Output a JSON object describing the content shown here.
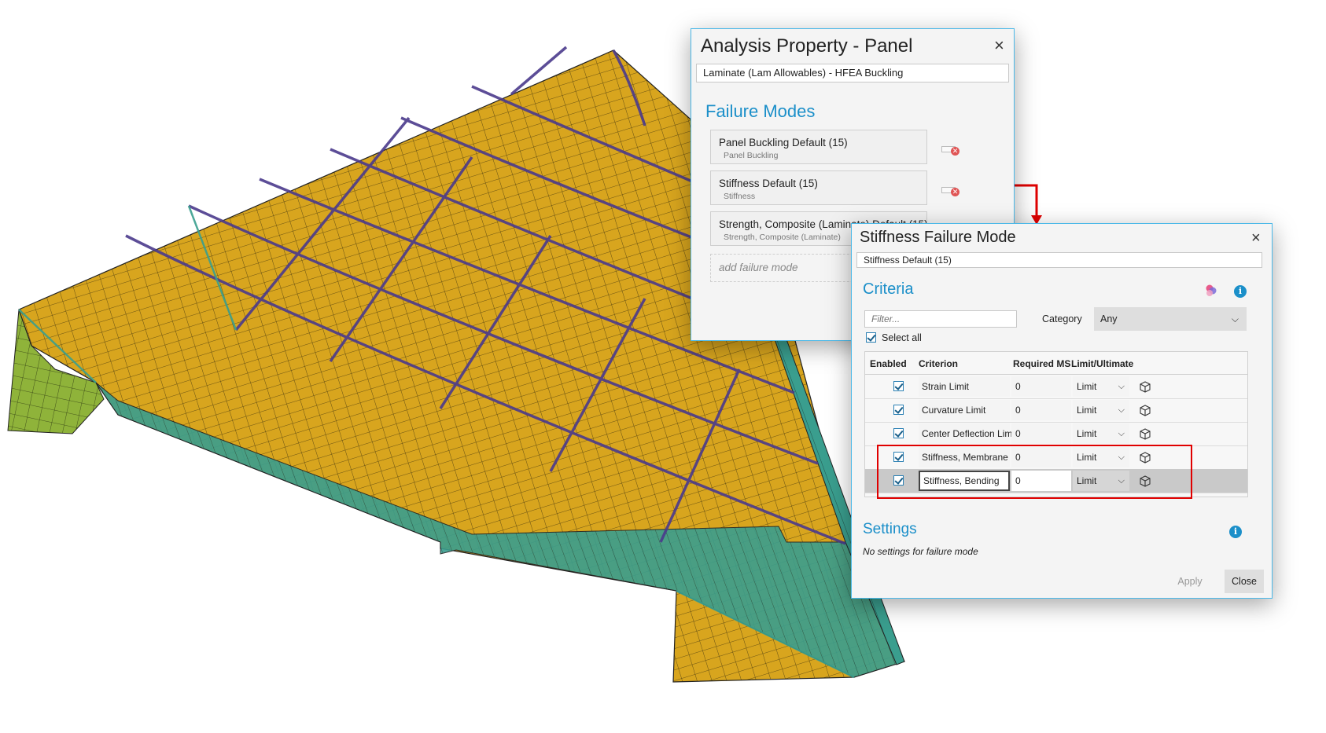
{
  "analysis_dialog": {
    "title": "Analysis Property - Panel",
    "close": "×",
    "property_name": "Laminate (Lam Allowables) - HFEA Buckling",
    "section_title": "Failure Modes",
    "failure_modes": [
      {
        "name": "Panel Buckling Default (15)",
        "type": "Panel Buckling"
      },
      {
        "name": "Stiffness Default (15)",
        "type": "Stiffness"
      },
      {
        "name": "Strength, Composite (Laminate) Default (15)",
        "type": "Strength, Composite (Laminate)"
      }
    ],
    "add_placeholder": "add failure mode"
  },
  "stiffness_dialog": {
    "title": "Stiffness Failure Mode",
    "close": "×",
    "mode_name": "Stiffness Default (15)",
    "criteria_title": "Criteria",
    "filter_placeholder": "Filter...",
    "category_label": "Category",
    "category_value": "Any",
    "select_all_label": "Select all",
    "columns": [
      "Enabled",
      "Criterion",
      "Required MS",
      "Limit/Ultimate"
    ],
    "rows": [
      {
        "criterion": "Strain Limit",
        "required_ms": "0",
        "limit": "Limit",
        "enabled": true
      },
      {
        "criterion": "Curvature Limit",
        "required_ms": "0",
        "limit": "Limit",
        "enabled": true
      },
      {
        "criterion": "Center Deflection Limit",
        "required_ms": "0",
        "limit": "Limit",
        "enabled": true
      },
      {
        "criterion": "Stiffness, Membrane",
        "required_ms": "0",
        "limit": "Limit",
        "enabled": true
      },
      {
        "criterion": "Stiffness, Bending",
        "required_ms": "0",
        "limit": "Limit",
        "enabled": true,
        "selected": true
      }
    ],
    "settings_title": "Settings",
    "settings_text": "No settings for failure mode",
    "apply_label": "Apply",
    "close_label": "Close"
  },
  "colors": {
    "accent": "#1b8fc9",
    "dialog_border": "#4ab8e8",
    "highlight": "#e00000",
    "mesh_panel": "#d8a51e",
    "mesh_spar": "#3a9e8e",
    "mesh_rib": "#4b3a8c",
    "mesh_side": "#8fb33a"
  },
  "icons": [
    "close-icon",
    "remove-icon",
    "chevron-down-icon",
    "cube-icon",
    "info-icon",
    "palette-icon"
  ]
}
